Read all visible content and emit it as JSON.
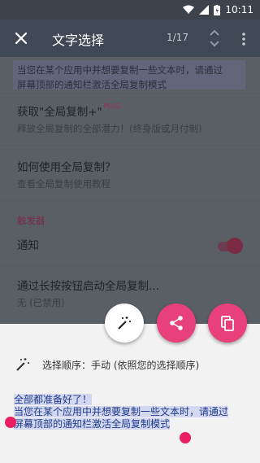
{
  "status_bar": {
    "time": "10:11"
  },
  "toolbar": {
    "title": "文字选择",
    "pager": "1/17"
  },
  "list": {
    "item_top": {
      "line1": "当您在某个应用中并想要复制一些文本时，请通过",
      "line2": "屏幕顶部的通知栏激活全局复制模式"
    },
    "item_upgrade": {
      "title": "获取\"全局复制+\"",
      "plus": "PLUS",
      "subtitle": "释放全局复制的全部潜力！(终身版或月付制)"
    },
    "item_howto": {
      "title": "如何使用全局复制？",
      "subtitle": "查看全局复制使用教程"
    },
    "section_trigger": "触发器",
    "item_notification": {
      "title": "通知"
    },
    "item_longpress": {
      "title": "通过长按按钮启动全局复制...",
      "subtitle": "无 (已禁用)"
    }
  },
  "sheet": {
    "order_text": "选择顺序：手动 (依照您的选择顺序)",
    "preview_line1": "全部都准备好了！",
    "preview_line2": "当您在某个应用中并想要复制一些文本时，请通过",
    "preview_line3": "屏幕顶部的通知栏激活全局复制模式"
  },
  "colors": {
    "toolbar": "#3f4855",
    "accent": "#e8407a"
  }
}
